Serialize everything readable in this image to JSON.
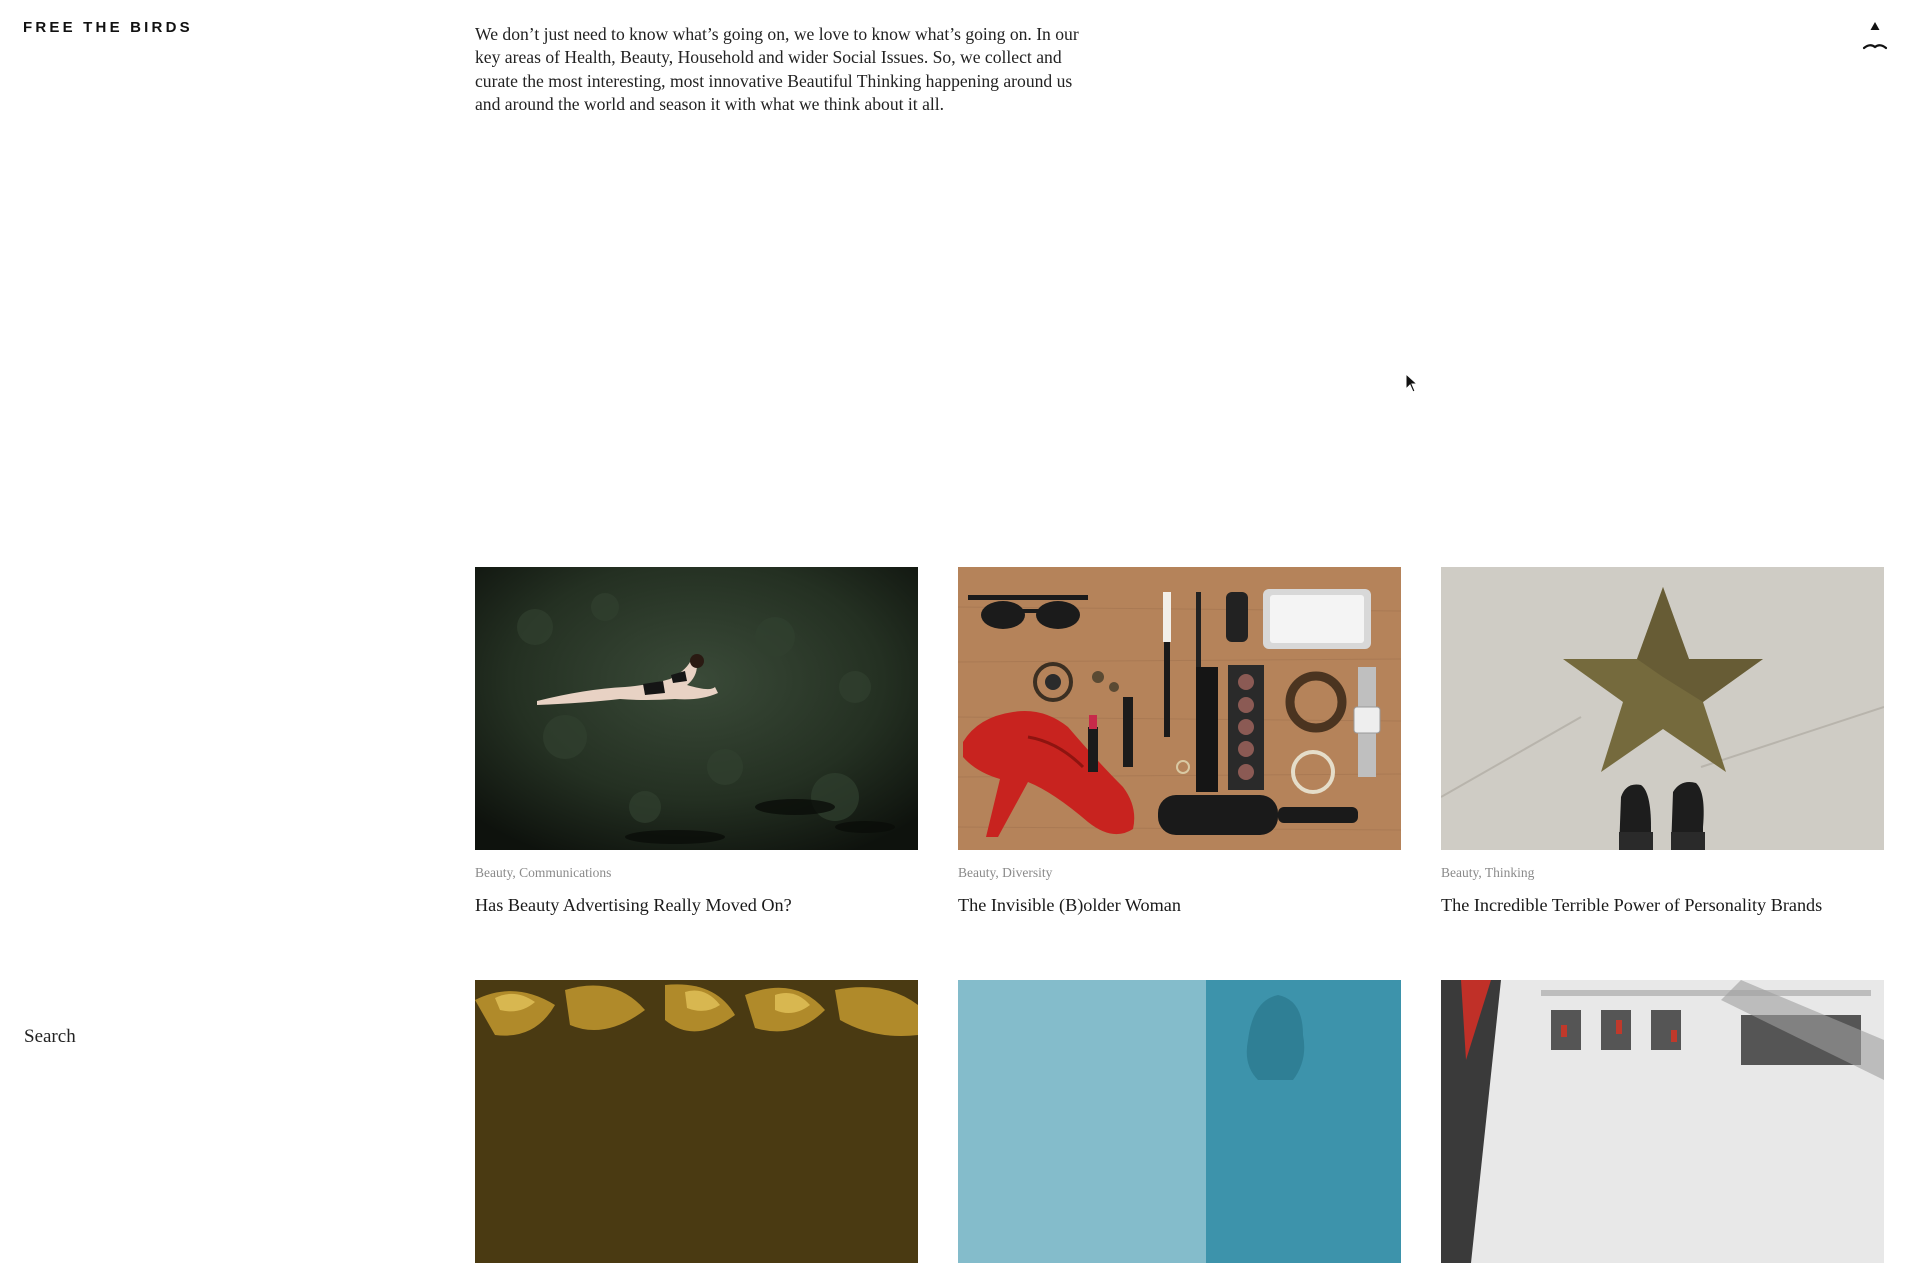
{
  "header": {
    "logo": "FREE THE BIRDS"
  },
  "intro": {
    "text": "We don’t just need to know what’s going on, we love to know what’s going on. In our key areas of Health, Beauty, Household and wider Social Issues. So, we collect and curate the most interesting, most innovative Beautiful Thinking happening around us and around the world and season it with what we think about it all."
  },
  "sidebar": {
    "search_label": "Search"
  },
  "icons": {
    "top_right": "bird-arrow-icon"
  },
  "colors": {
    "category_text": "#8a8a8a",
    "title_text": "#1a1a1a",
    "background": "#ffffff"
  },
  "articles": [
    {
      "categories": [
        "Beauty",
        "Communications"
      ],
      "title": "Has Beauty Advertising Really Moved On?",
      "image": "woman-floating-in-water"
    },
    {
      "categories": [
        "Beauty",
        "Diversity"
      ],
      "title": "The Invisible (B)older Woman",
      "image": "flatlay-red-shoe-makeup"
    },
    {
      "categories": [
        "Beauty",
        "Thinking"
      ],
      "title": "The Incredible Terrible Power of Personality Brands",
      "image": "star-on-pavement-feet"
    },
    {
      "categories": [],
      "title": "",
      "image": "gold-bags"
    },
    {
      "categories": [],
      "title": "",
      "image": "teal-silhouette"
    },
    {
      "categories": [],
      "title": "",
      "image": "store-aerial-view"
    }
  ]
}
